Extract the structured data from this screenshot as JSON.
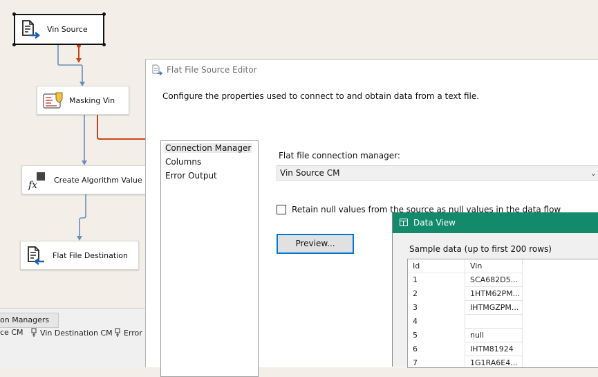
{
  "flow": {
    "nodes": {
      "vin_source": {
        "label": "Vin Source"
      },
      "masking_vin": {
        "label": "Masking Vin"
      },
      "create_algorithm": {
        "label": "Create Algorithm Value"
      },
      "flat_file_destination": {
        "label": "Flat File Destination"
      }
    },
    "path_colors": {
      "default": "#6b8cb8",
      "error": "#c8451a"
    }
  },
  "tray": {
    "tab_label": "on Managers",
    "items": [
      {
        "label": "ce CM",
        "icon": "connection-plug-icon"
      },
      {
        "label": "Vin Destination CM",
        "icon": "connection-plug-icon"
      },
      {
        "label": "Error H",
        "icon": "connection-plug-icon"
      }
    ]
  },
  "editor": {
    "title": "Flat File Source Editor",
    "description": "Configure the properties used to connect to and obtain data from a text file.",
    "nav": [
      "Connection Manager",
      "Columns",
      "Error Output"
    ],
    "connection_label": "Flat file connection manager:",
    "connection_value": "Vin Source CM",
    "retain_nulls_label": "Retain null values from the source as null values in the data flow",
    "retain_nulls_checked": false,
    "preview_button": "Preview..."
  },
  "dataview": {
    "title": "Data View",
    "caption": "Sample data (up to first 200 rows)",
    "accent": "#148a6d",
    "columns": [
      "Id",
      "Vin"
    ],
    "rows": [
      [
        "1",
        "SCA682D5..."
      ],
      [
        "2",
        "1HTM62PM..."
      ],
      [
        "3",
        "IHTMGZPM..."
      ],
      [
        "4",
        ""
      ],
      [
        "5",
        "null"
      ],
      [
        "6",
        "IHTM81924"
      ],
      [
        "7",
        "1G1RA6E4..."
      ]
    ]
  }
}
